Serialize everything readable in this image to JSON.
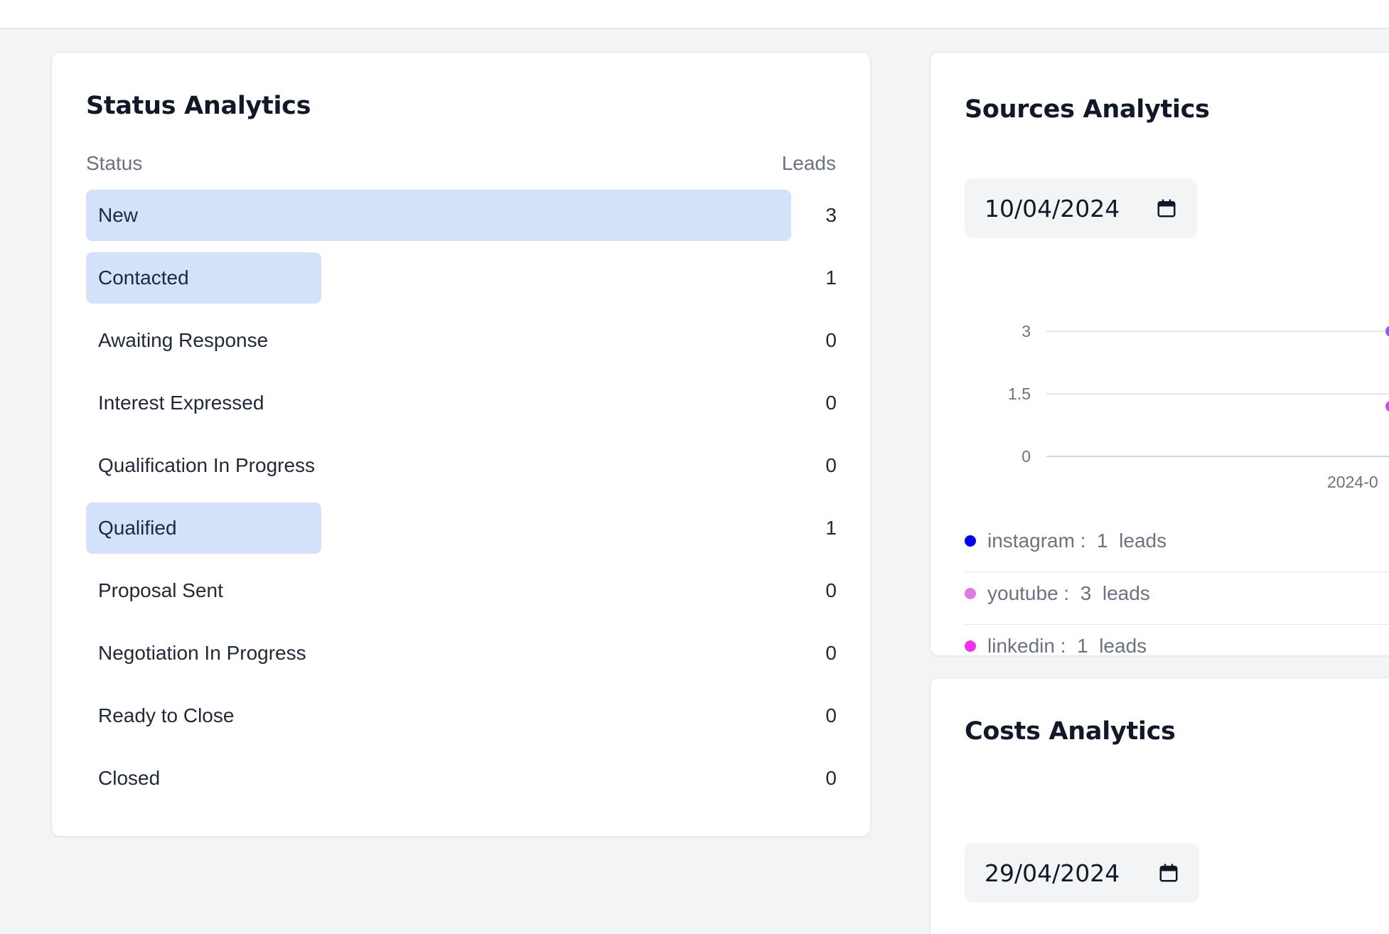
{
  "status_card": {
    "title": "Status Analytics",
    "col_status": "Status",
    "col_leads": "Leads",
    "max_leads": 3,
    "rows": [
      {
        "label": "New",
        "count": "3",
        "value": 3
      },
      {
        "label": "Contacted",
        "count": "1",
        "value": 1
      },
      {
        "label": "Awaiting Response",
        "count": "0",
        "value": 0
      },
      {
        "label": "Interest Expressed",
        "count": "0",
        "value": 0
      },
      {
        "label": "Qualification In Progress",
        "count": "0",
        "value": 0
      },
      {
        "label": "Qualified",
        "count": "1",
        "value": 1
      },
      {
        "label": "Proposal Sent",
        "count": "0",
        "value": 0
      },
      {
        "label": "Negotiation In Progress",
        "count": "0",
        "value": 0
      },
      {
        "label": "Ready to Close",
        "count": "0",
        "value": 0
      },
      {
        "label": "Closed",
        "count": "0",
        "value": 0
      }
    ]
  },
  "sources_card": {
    "title": "Sources Analytics",
    "date_value": "10/04/2024",
    "legend": [
      {
        "dot_color": "#0000ee",
        "text": "instagram :  1  leads"
      },
      {
        "dot_color": "#e07be0",
        "text": "youtube :  3  leads"
      },
      {
        "dot_color": "#ee33ee",
        "text": "linkedin :  1  leads"
      }
    ]
  },
  "chart_data": {
    "type": "line",
    "y_ticks": [
      "3",
      "1.5",
      "0"
    ],
    "ylim": [
      0,
      3
    ],
    "x_tick_visible": "2024-0",
    "points": [
      {
        "value": 3,
        "color": "#8b5cf6"
      },
      {
        "value": 1.2,
        "color": "#d946ef"
      }
    ],
    "grid": true
  },
  "costs_card": {
    "title": "Costs Analytics",
    "date_value": "29/04/2024"
  },
  "colors": {
    "bar": "#d3e1f9",
    "page_bg": "#f3f4f6"
  }
}
